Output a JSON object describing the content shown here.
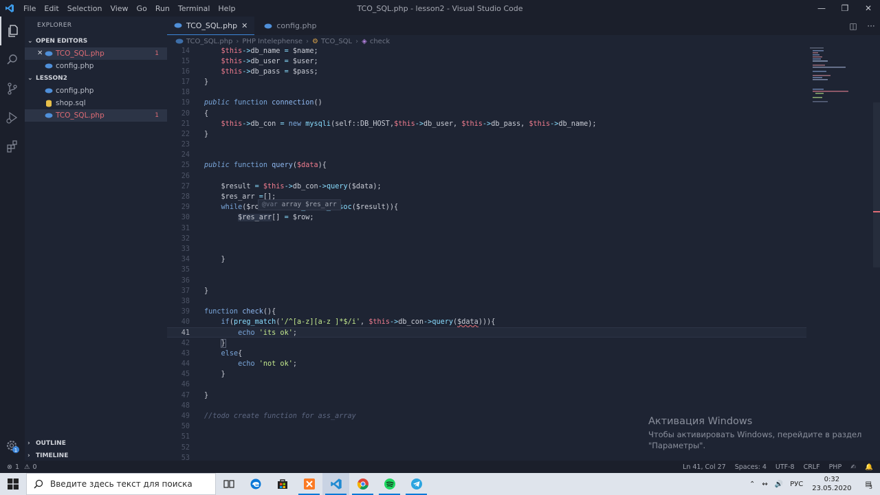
{
  "window": {
    "title": "TCO_SQL.php - lesson2 - Visual Studio Code",
    "menu": [
      "File",
      "Edit",
      "Selection",
      "View",
      "Go",
      "Run",
      "Terminal",
      "Help"
    ]
  },
  "sidebar": {
    "title": "EXPLORER",
    "open_editors_label": "OPEN EDITORS",
    "open_editors": [
      {
        "name": "TCO_SQL.php",
        "badge": "1",
        "error": true
      },
      {
        "name": "config.php",
        "badge": "",
        "error": false
      }
    ],
    "project_label": "LESSON2",
    "files": [
      {
        "name": "config.php",
        "badge": "",
        "error": false,
        "icon": "php-icon"
      },
      {
        "name": "shop.sql",
        "badge": "",
        "error": false,
        "icon": "database-icon"
      },
      {
        "name": "TCO_SQL.php",
        "badge": "1",
        "error": true,
        "icon": "php-icon"
      }
    ],
    "outline_label": "OUTLINE",
    "timeline_label": "TIMELINE"
  },
  "tabs": [
    {
      "label": "TCO_SQL.php",
      "active": true
    },
    {
      "label": "config.php",
      "active": false
    }
  ],
  "breadcrumb": {
    "file": "TCO_SQL.php",
    "ns": "PHP Intelephense",
    "cls": "TCO_SQL",
    "method": "check"
  },
  "editor": {
    "line_numbers": [
      "14",
      "15",
      "16",
      "17",
      "18",
      "19",
      "20",
      "21",
      "22",
      "23",
      "24",
      "25",
      "26",
      "27",
      "28",
      "29",
      "30",
      "31",
      "32",
      "33",
      "34",
      "35",
      "36",
      "37",
      "38",
      "39",
      "40",
      "41",
      "42",
      "43",
      "44",
      "45",
      "46",
      "47",
      "48",
      "49",
      "50",
      "51",
      "52",
      "53"
    ],
    "hover_tooltip": {
      "tag": "@var",
      "text": "array $res_arr"
    },
    "current_line": "41"
  },
  "activation": {
    "title": "Активация Windows",
    "line1": "Чтобы активировать Windows, перейдите в раздел",
    "line2": "\"Параметры\"."
  },
  "statusbar": {
    "errors": "1",
    "warnings": "0",
    "position": "Ln 41, Col 27",
    "spaces": "Spaces: 4",
    "encoding": "UTF-8",
    "eol": "CRLF",
    "language": "PHP"
  },
  "taskbar": {
    "search_placeholder": "Введите здесь текст для поиска",
    "lang": "РУС",
    "time": "0:32",
    "date": "23.05.2020",
    "notifications": "3"
  },
  "colors": {
    "accent": "#3d86d9",
    "error": "#e06c75",
    "editor_bg": "#1e2433"
  }
}
